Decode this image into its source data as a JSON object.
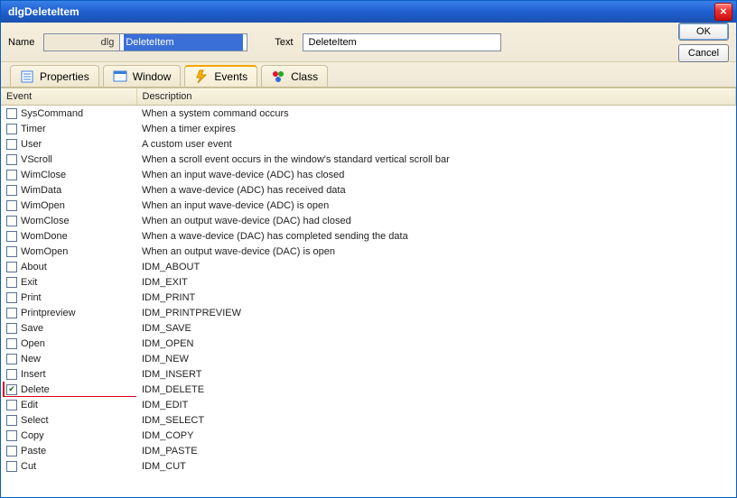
{
  "titlebar": {
    "title": "dlgDeleteItem"
  },
  "toolbar": {
    "name_label": "Name",
    "name_prefix": "dlg",
    "name_value": "DeleteItem",
    "text_label": "Text",
    "text_value": "DeleteItem",
    "ok_label": "OK",
    "cancel_label": "Cancel"
  },
  "tabs": {
    "properties": "Properties",
    "window": "Window",
    "events": "Events",
    "class": "Class"
  },
  "table": {
    "header_event": "Event",
    "header_description": "Description",
    "rows": [
      {
        "checked": false,
        "event": "SysCommand",
        "desc": "When a system command occurs"
      },
      {
        "checked": false,
        "event": "Timer",
        "desc": "When a timer expires"
      },
      {
        "checked": false,
        "event": "User",
        "desc": "A custom user event"
      },
      {
        "checked": false,
        "event": "VScroll",
        "desc": "When a scroll event occurs in the window's standard vertical scroll bar"
      },
      {
        "checked": false,
        "event": "WimClose",
        "desc": "When an input wave-device (ADC) has closed"
      },
      {
        "checked": false,
        "event": "WimData",
        "desc": "When a wave-device (ADC) has received data"
      },
      {
        "checked": false,
        "event": "WimOpen",
        "desc": "When an input wave-device (ADC) is open"
      },
      {
        "checked": false,
        "event": "WomClose",
        "desc": "When an output wave-device (DAC) had closed"
      },
      {
        "checked": false,
        "event": "WomDone",
        "desc": "When a wave-device (DAC) has completed sending the data"
      },
      {
        "checked": false,
        "event": "WomOpen",
        "desc": "When an output wave-device (DAC) is open"
      },
      {
        "checked": false,
        "event": "About",
        "desc": "IDM_ABOUT"
      },
      {
        "checked": false,
        "event": "Exit",
        "desc": "IDM_EXIT"
      },
      {
        "checked": false,
        "event": "Print",
        "desc": "IDM_PRINT"
      },
      {
        "checked": false,
        "event": "Printpreview",
        "desc": "IDM_PRINTPREVIEW"
      },
      {
        "checked": false,
        "event": "Save",
        "desc": "IDM_SAVE"
      },
      {
        "checked": false,
        "event": "Open",
        "desc": "IDM_OPEN"
      },
      {
        "checked": false,
        "event": "New",
        "desc": "IDM_NEW"
      },
      {
        "checked": false,
        "event": "Insert",
        "desc": "IDM_INSERT"
      },
      {
        "checked": true,
        "event": "Delete",
        "desc": "IDM_DELETE",
        "highlight": true
      },
      {
        "checked": false,
        "event": "Edit",
        "desc": "IDM_EDIT"
      },
      {
        "checked": false,
        "event": "Select",
        "desc": "IDM_SELECT"
      },
      {
        "checked": false,
        "event": "Copy",
        "desc": "IDM_COPY"
      },
      {
        "checked": false,
        "event": "Paste",
        "desc": "IDM_PASTE"
      },
      {
        "checked": false,
        "event": "Cut",
        "desc": "IDM_CUT"
      }
    ]
  }
}
